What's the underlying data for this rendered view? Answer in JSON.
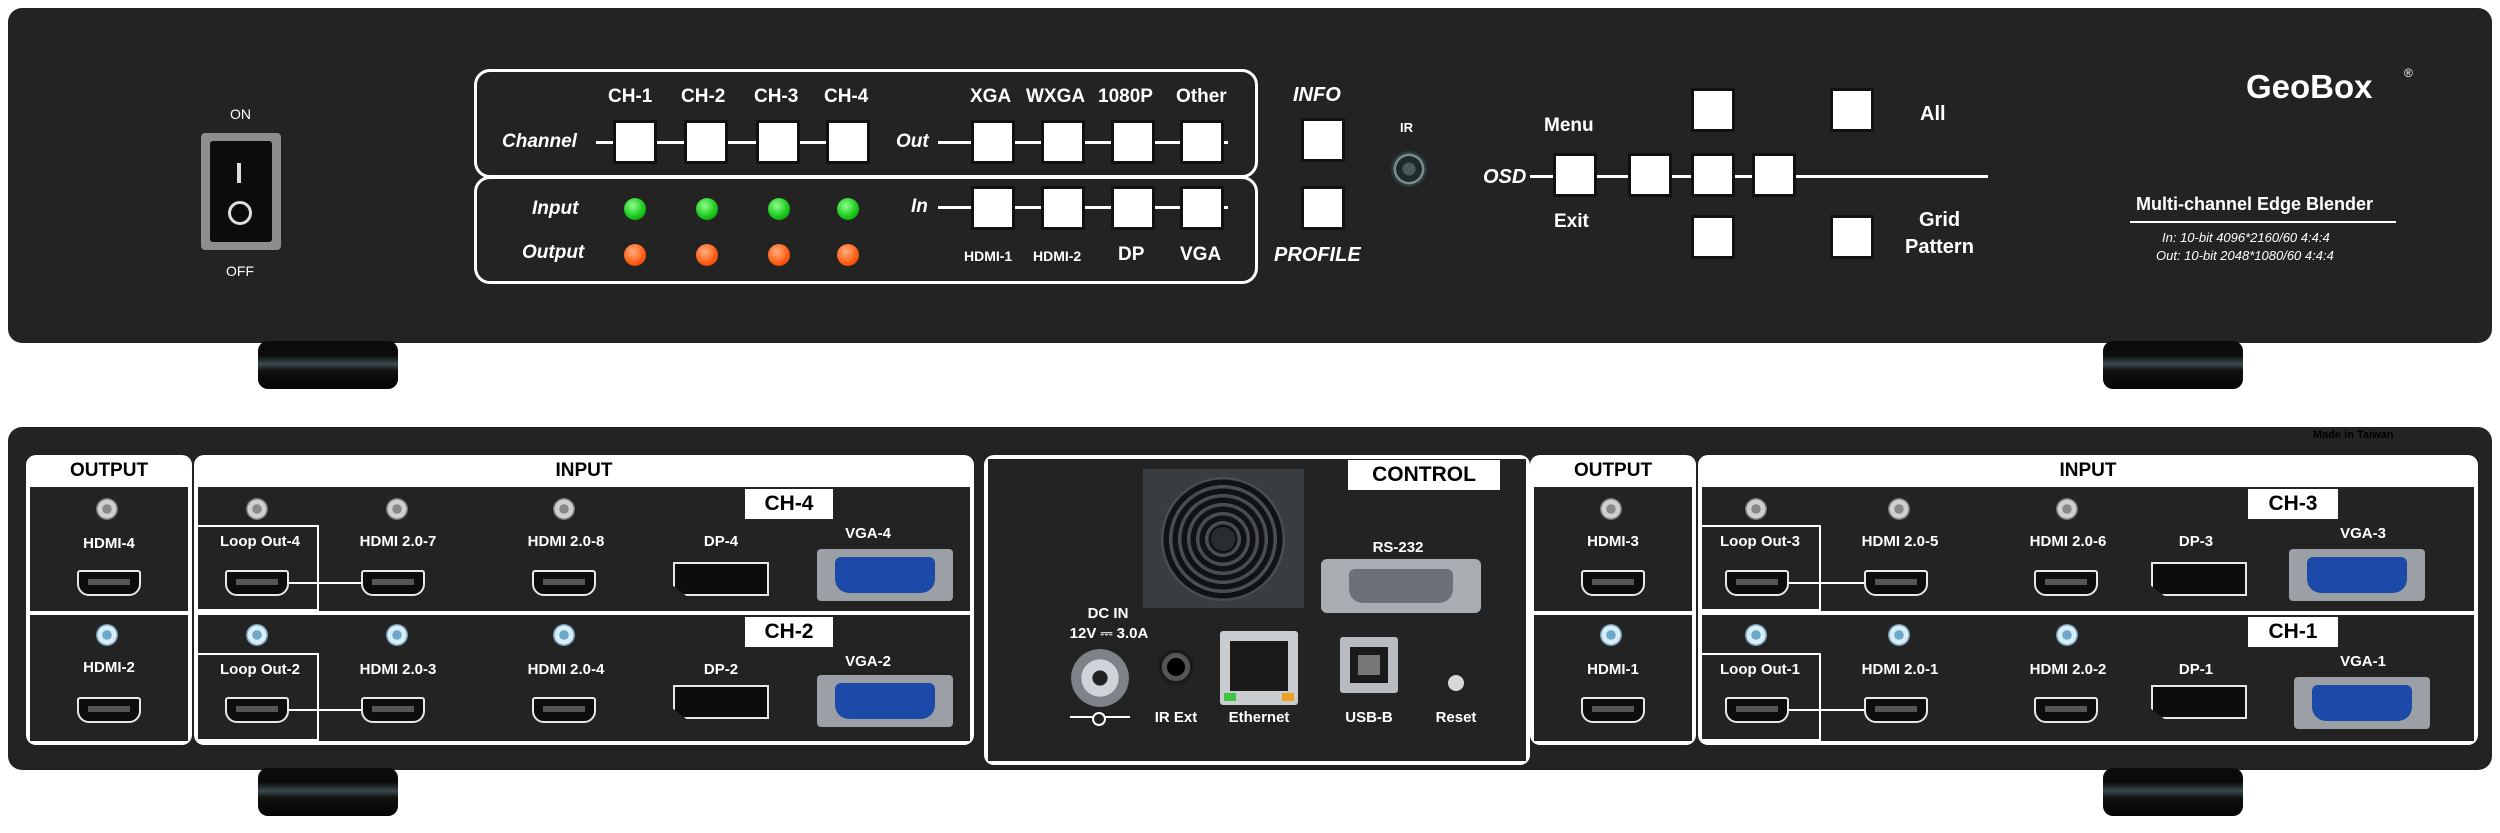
{
  "front": {
    "power": {
      "on": "ON",
      "off": "OFF"
    },
    "channel_label": "Channel",
    "channels": [
      "CH-1",
      "CH-2",
      "CH-3",
      "CH-4"
    ],
    "out_label": "Out",
    "outputs": [
      "XGA",
      "WXGA",
      "1080P",
      "Other"
    ],
    "input_label": "Input",
    "output_label": "Output",
    "in_label": "In",
    "inputs": [
      "HDMI-1",
      "HDMI-2",
      "DP",
      "VGA"
    ],
    "info": "INFO",
    "profile": "PROFILE",
    "ir": "IR",
    "osd": "OSD",
    "menu": "Menu",
    "exit": "Exit",
    "all": "All",
    "grid": "Grid",
    "pattern": "Pattern",
    "brand": "GeoBox",
    "brand_mark": "®",
    "model": "Multi-channel Edge Blender",
    "spec_in": "In: 10-bit 4096*2160/60 4:4:4",
    "spec_out": "Out: 10-bit 2048*1080/60 4:4:4"
  },
  "rear": {
    "made_in": "Made in Taiwan",
    "output_header": "OUTPUT",
    "input_header": "INPUT",
    "control_header": "CONTROL",
    "left": {
      "outputs": [
        "HDMI-4",
        "HDMI-2"
      ],
      "ch_top": "CH-4",
      "ch_bottom": "CH-2",
      "top": [
        "Loop Out-4",
        "HDMI 2.0-7",
        "HDMI 2.0-8",
        "DP-4",
        "VGA-4"
      ],
      "bottom": [
        "Loop Out-2",
        "HDMI 2.0-3",
        "HDMI 2.0-4",
        "DP-2",
        "VGA-2"
      ]
    },
    "control": {
      "rs232": "RS-232",
      "dc_in": "DC IN",
      "dc_rating": "12V ⎓ 3.0A",
      "ir_ext": "IR Ext",
      "ethernet": "Ethernet",
      "usb": "USB-B",
      "reset": "Reset"
    },
    "right": {
      "outputs": [
        "HDMI-3",
        "HDMI-1"
      ],
      "ch_top": "CH-3",
      "ch_bottom": "CH-1",
      "top": [
        "Loop Out-3",
        "HDMI 2.0-5",
        "HDMI 2.0-6",
        "DP-3",
        "VGA-3"
      ],
      "bottom": [
        "Loop Out-1",
        "HDMI 2.0-1",
        "HDMI 2.0-2",
        "DP-1",
        "VGA-1"
      ]
    }
  }
}
